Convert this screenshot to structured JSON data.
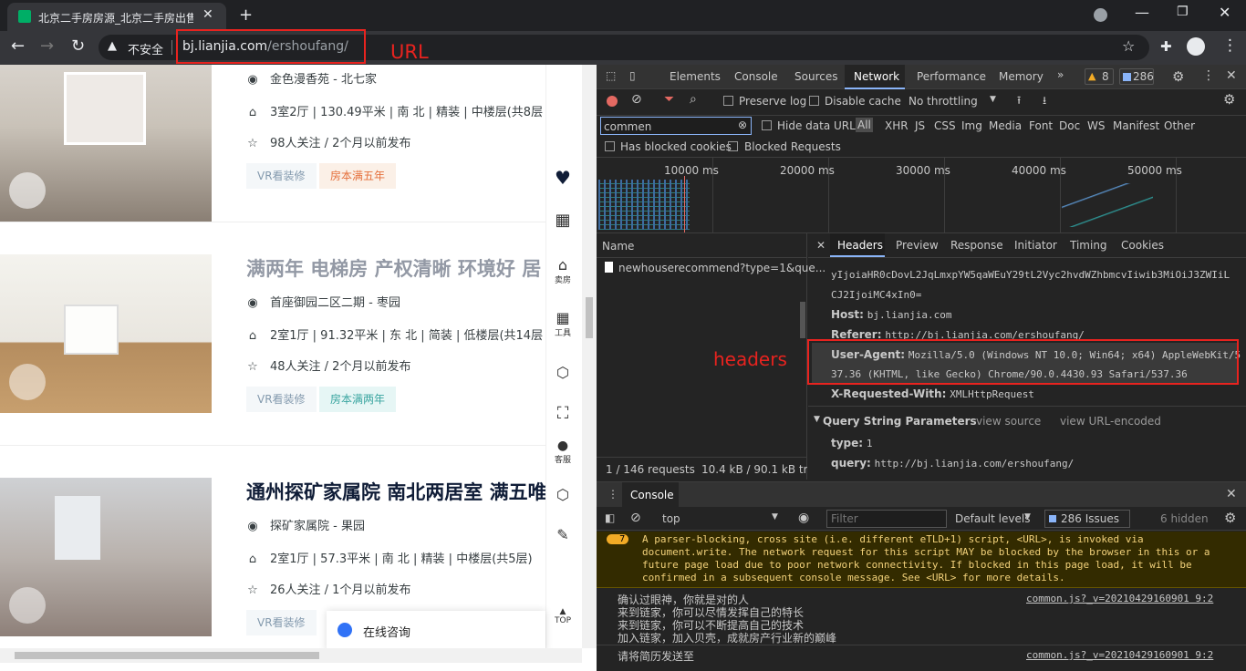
{
  "browser": {
    "tab_title": "北京二手房房源_北京二手房出售",
    "insecure_label": "不安全",
    "url_host": "bj.lianjia.com",
    "url_path": "/ershoufang/"
  },
  "annotations": {
    "url": "URL",
    "headers": "headers"
  },
  "listings": [
    {
      "title": "",
      "community": "金色漫香苑 - 北七家",
      "info": "3室2厅 | 130.49平米 | 南 北 | 精装 | 中楼层(共8层",
      "follow": "98人关注 / 2个月以前发布",
      "tags": [
        "VR看装修",
        "房本满五年"
      ]
    },
    {
      "title": "满两年 电梯房 产权清晰 环境好 居",
      "community": "首座御园二区二期 - 枣园",
      "info": "2室1厅 | 91.32平米 | 东 北 | 简装 | 低楼层(共14层",
      "follow": "48人关注 / 2个月以前发布",
      "tags": [
        "VR看装修",
        "房本满两年"
      ]
    },
    {
      "title": "通州探矿家属院 南北两居室 满五唯",
      "community": "探矿家属院 - 果园",
      "info": "2室1厅 | 57.3平米 | 南 北 | 精装 | 中楼层(共5层)",
      "follow": "26人关注 / 1个月以前发布",
      "tags": [
        "VR看装修",
        ""
      ]
    }
  ],
  "sidebar": {
    "sell": "卖房",
    "tools": "工具",
    "service": "客服",
    "top": "TOP"
  },
  "chat": {
    "label": "在线咨询"
  },
  "devtools": {
    "tabs": [
      "Elements",
      "Console",
      "Sources",
      "Network",
      "Performance",
      "Memory"
    ],
    "warn_count": "8",
    "issue_count": "286",
    "preserve_log": "Preserve log",
    "disable_cache": "Disable cache",
    "throttling": "No throttling",
    "filter_value": "commen",
    "hide_data_urls": "Hide data URLs",
    "all": "All",
    "types": [
      "XHR",
      "JS",
      "CSS",
      "Img",
      "Media",
      "Font",
      "Doc",
      "WS",
      "Manifest",
      "Other"
    ],
    "has_blocked_cookies": "Has blocked cookies",
    "blocked_requests": "Blocked Requests",
    "timeline": [
      "10000 ms",
      "20000 ms",
      "30000 ms",
      "40000 ms",
      "50000 ms"
    ],
    "name_header": "Name",
    "request_name": "newhouserecommend?type=1&que...",
    "status_requests": "1 / 146 requests",
    "status_size": "10.4 kB / 90.1 kB tran",
    "detail_tabs": [
      "Headers",
      "Preview",
      "Response",
      "Initiator",
      "Timing",
      "Cookies"
    ],
    "cookie_line1": "yIjoiaHR0cDovL2JqLmxpYW5qaWEuY29tL2Vyc2hvdWZhbmcvIiwib3MiOiJ3ZWIiL",
    "cookie_line2": "CJ2IjoiMC4xIn0=",
    "headers": [
      {
        "k": "Host:",
        "v": "bj.lianjia.com"
      },
      {
        "k": "Referer:",
        "v": "http://bj.lianjia.com/ershoufang/"
      },
      {
        "k": "User-Agent:",
        "v": "Mozilla/5.0 (Windows NT 10.0; Win64; x64) AppleWebKit/5"
      },
      {
        "k": "",
        "v": "37.36 (KHTML, like Gecko) Chrome/90.0.4430.93 Safari/537.36"
      },
      {
        "k": "X-Requested-With:",
        "v": "XMLHttpRequest"
      }
    ],
    "qs_title": "Query String Parameters",
    "view_source": "view source",
    "view_url_encoded": "view URL-encoded",
    "params": [
      {
        "k": "type:",
        "v": "1"
      },
      {
        "k": "query:",
        "v": "http://bj.lianjia.com/ershoufang/"
      }
    ],
    "console_tab": "Console",
    "context": "top",
    "filter_placeholder": "Filter",
    "levels": "Default levels",
    "issues": "286 Issues",
    "hidden": "6 hidden",
    "warning_count": "7",
    "warning_lines": [
      "A parser-blocking, cross site (i.e. different eTLD+1) script, <URL>, is invoked via",
      "document.write. The network request for this script MAY be blocked by the browser in this or a",
      "future page load due to poor network connectivity. If blocked in this page load, it will be",
      "confirmed in a subsequent console message. See <URL> for more details."
    ],
    "log_lines": [
      "确认过眼神，你就是对的人",
      "来到链家，你可以尽情发挥自己的特长",
      "来到链家，你可以不断提高自己的技术",
      "加入链家，加入贝壳，成就房产行业新的巅峰"
    ],
    "log_source": "common.js?_v=20210429160901 9:2",
    "log2": "请将简历发送至",
    "log2_source": "common.js?_v=20210429160901 9:2"
  },
  "colors": {
    "annotation_red": "#e8231f",
    "accent_blue": "#1a73e8"
  }
}
